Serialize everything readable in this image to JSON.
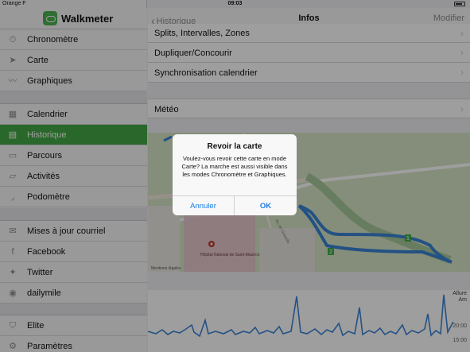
{
  "status": {
    "carrier": "Orange F",
    "time": "09:03"
  },
  "sidebar": {
    "app_title": "Walkmeter",
    "groups": [
      [
        {
          "label": "Chronomètre",
          "icon": "stopwatch-icon"
        },
        {
          "label": "Carte",
          "icon": "location-arrow-icon"
        },
        {
          "label": "Graphiques",
          "icon": "graph-icon"
        }
      ],
      [
        {
          "label": "Calendrier",
          "icon": "calendar-grid-icon"
        },
        {
          "label": "Historique",
          "icon": "history-list-icon",
          "active": true
        },
        {
          "label": "Parcours",
          "icon": "route-icon"
        },
        {
          "label": "Activités",
          "icon": "activities-icon"
        },
        {
          "label": "Podomètre",
          "icon": "shoe-icon"
        }
      ],
      [
        {
          "label": "Mises à jour courriel",
          "icon": "mail-icon"
        },
        {
          "label": "Facebook",
          "icon": "facebook-icon"
        },
        {
          "label": "Twitter",
          "icon": "twitter-icon"
        },
        {
          "label": "dailymile",
          "icon": "dailymile-icon"
        }
      ],
      [
        {
          "label": "Elite",
          "icon": "shield-icon"
        },
        {
          "label": "Paramètres",
          "icon": "gear-icon"
        }
      ]
    ]
  },
  "navbar": {
    "back_label": "Historique",
    "title": "Infos",
    "action_label": "Modifier"
  },
  "rows": [
    {
      "label": "Splits, Intervalles, Zones"
    },
    {
      "label": "Dupliquer/Concourir"
    },
    {
      "label": "Synchronisation calendrier"
    },
    {
      "label": "Météo"
    }
  ],
  "map": {
    "hospital_label": "Hôpital National de Saint-Maurice",
    "street_label": "Av. de Gravelle",
    "credit": "Mentions légales",
    "markers": [
      "1",
      "2"
    ]
  },
  "chart": {
    "ylabel_line1": "Allure",
    "ylabel_line2": "Am",
    "ticks": [
      "20:00",
      "15:00"
    ]
  },
  "alert": {
    "title": "Revoir la carte",
    "message": "Voulez-vous revoir cette carte en mode Carte? La marche est aussi visible dans les modes Chronomètre et Graphiques.",
    "cancel_label": "Annuler",
    "ok_label": "OK"
  },
  "colors": {
    "accent": "#43a845",
    "alert_button": "#1a7ce6",
    "track": "#3b84d6"
  }
}
